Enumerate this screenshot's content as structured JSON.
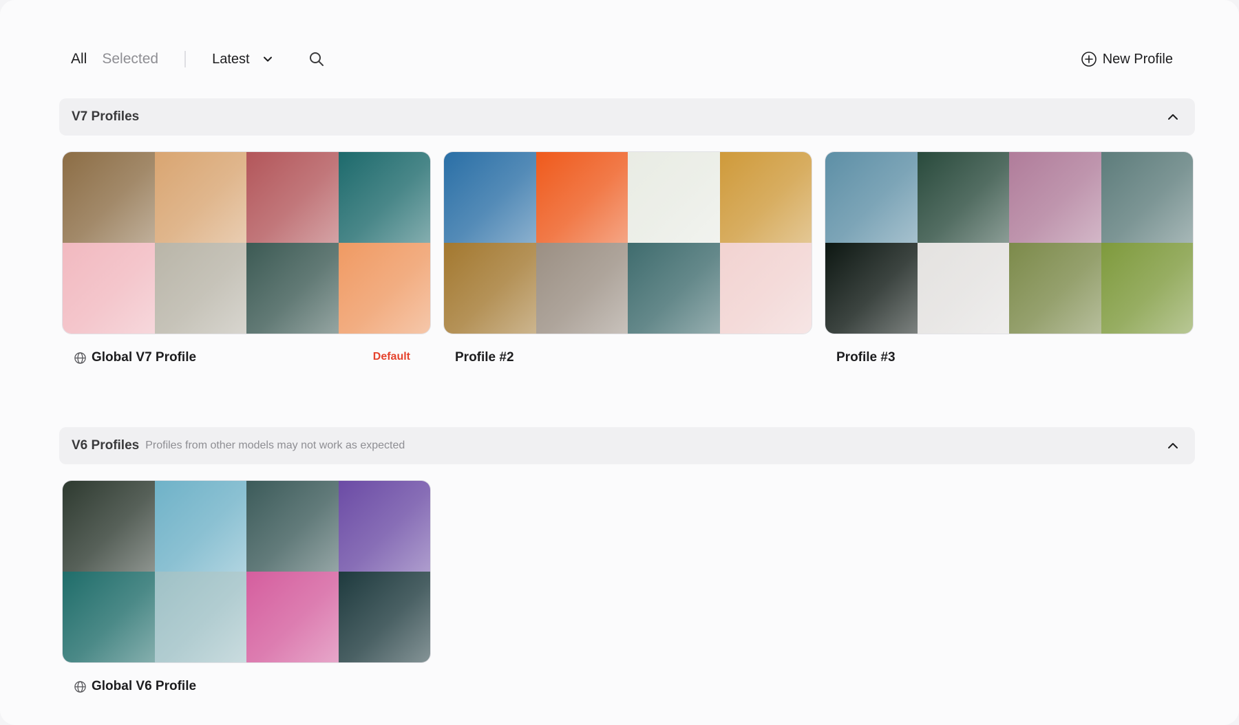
{
  "toolbar": {
    "tab_all": "All",
    "tab_selected": "Selected",
    "sort_label": "Latest",
    "sort_icon": "chevron-down-icon",
    "search_icon": "search-icon",
    "new_profile_label": "New Profile",
    "new_profile_icon": "plus-circle-icon"
  },
  "colors": {
    "accent_default": "#e5432d",
    "text": "#1d1d1f",
    "muted": "#8e8e93",
    "section_bg": "#f0f0f2"
  },
  "v7": {
    "title": "V7 Profiles",
    "toggle_icon": "chevron-up-icon",
    "cards": [
      {
        "name": "Global V7 Profile",
        "icon": "globe-icon",
        "badge": "Default",
        "tiles": [
          "#8c6d45",
          "#d9a571",
          "#b3565a",
          "#1d6a6c",
          "#f2b9c0",
          "#b9b5a8",
          "#3c5a54",
          "#f09a63"
        ]
      },
      {
        "name": "Profile #2",
        "tiles": [
          "#2a6fa6",
          "#ef5a1c",
          "#e9ece4",
          "#cf9a3a",
          "#a3782f",
          "#9b8f83",
          "#3f6c6e",
          "#f2d3d1"
        ]
      },
      {
        "name": "Profile #3",
        "tiles": [
          "#5d8fa6",
          "#294a3c",
          "#b07c9a",
          "#5d7c7b",
          "#0d1712",
          "#e4e2e0",
          "#7c8a4a",
          "#7e9a3c"
        ]
      }
    ]
  },
  "v6": {
    "title": "V6 Profiles",
    "note": "Profiles from other models may not work as expected",
    "toggle_icon": "chevron-up-icon",
    "cards": [
      {
        "name": "Global V6 Profile",
        "icon": "globe-icon",
        "tiles": [
          "#2e3a30",
          "#6fb2c8",
          "#3c5b5a",
          "#6b4ba5",
          "#1f6d6a",
          "#9fc1c6",
          "#d55e9e",
          "#1e3a3e"
        ]
      }
    ]
  }
}
